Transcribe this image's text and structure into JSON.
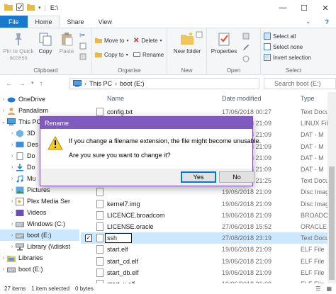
{
  "window": {
    "title": "E:\\"
  },
  "tabs": [
    {
      "label": "File"
    },
    {
      "label": "Home"
    },
    {
      "label": "Share"
    },
    {
      "label": "View"
    }
  ],
  "ribbon": {
    "clipboard": {
      "label": "Clipboard",
      "pin": "Pin to Quick access",
      "copy": "Copy",
      "paste": "Paste"
    },
    "organise": {
      "label": "Organise",
      "move_to": "Move to",
      "copy_to": "Copy to",
      "delete": "Delete",
      "rename": "Rename"
    },
    "new": {
      "label": "New",
      "new_folder": "New folder"
    },
    "open": {
      "label": "Open",
      "properties": "Properties"
    },
    "select": {
      "label": "Select",
      "select_all": "Select all",
      "select_none": "Select none",
      "invert": "Invert selection"
    }
  },
  "address": {
    "this_pc": "This PC",
    "boot": "boot (E:)",
    "search_placeholder": "Search boot (E:)"
  },
  "columns": {
    "name": "Name",
    "date": "Date modified",
    "type": "Type"
  },
  "nav": {
    "items": [
      {
        "label": "OneDrive"
      },
      {
        "label": "Pandalism"
      },
      {
        "label": "This PC"
      },
      {
        "label": "3D"
      },
      {
        "label": "Des"
      },
      {
        "label": "Do"
      },
      {
        "label": "Do"
      },
      {
        "label": "Mu"
      },
      {
        "label": "Pictures"
      },
      {
        "label": "Plex Media Ser"
      },
      {
        "label": "Videos"
      },
      {
        "label": "Windows (C:)"
      },
      {
        "label": "boot (E:)"
      },
      {
        "label": "Library (\\\\diskst"
      },
      {
        "label": "Libraries"
      },
      {
        "label": "boot (E:)"
      }
    ]
  },
  "files": [
    {
      "name": "config.txt",
      "date": "17/06/2018 00:27",
      "type": "Text Docu"
    },
    {
      "name": "",
      "date": "19/06/2018 21:09",
      "type": "LINUX File"
    },
    {
      "name": "",
      "date": "19/06/2018 21:09",
      "type": "DAT - M"
    },
    {
      "name": "",
      "date": "19/06/2018 21:09",
      "type": "DAT - M"
    },
    {
      "name": "",
      "date": "19/06/2018 21:09",
      "type": "DAT - M"
    },
    {
      "name": "",
      "date": "19/06/2018 21:09",
      "type": "DAT - M"
    },
    {
      "name": "",
      "date": "27/08/2018 21:25",
      "type": "Text Docu"
    },
    {
      "name": "",
      "date": "19/06/2018 21:09",
      "type": "Disc Imag"
    },
    {
      "name": "kernel7.img",
      "date": "19/06/2018 21:09",
      "type": "Disc Imag"
    },
    {
      "name": "LICENCE.broadcom",
      "date": "19/06/2018 21:09",
      "type": "BROADCO"
    },
    {
      "name": "LICENSE.oracle",
      "date": "27/06/2018 15:52",
      "type": "ORACLE F"
    },
    {
      "name": "ssh",
      "date": "27/08/2018 23:19",
      "type": "Text Docu"
    },
    {
      "name": "start.elf",
      "date": "19/06/2018 21:09",
      "type": "ELF File"
    },
    {
      "name": "start_cd.elf",
      "date": "19/06/2018 21:09",
      "type": "ELF File"
    },
    {
      "name": "start_db.elf",
      "date": "19/06/2018 21:09",
      "type": "ELF File"
    },
    {
      "name": "start_x.elf",
      "date": "19/06/2018 21:09",
      "type": "ELF File"
    }
  ],
  "status": {
    "items": "27 items",
    "selected": "1 item selected",
    "size": "0 bytes"
  },
  "dialog": {
    "title": "Rename",
    "message1": "If you change a filename extension, the file might become unusable.",
    "message2": "Are you sure you want to change it?",
    "yes": "Yes",
    "no": "No"
  },
  "colors": {
    "file_tab": "#1979ca",
    "dialog_title": "#7f5bbf",
    "selection": "#cce8ff"
  }
}
